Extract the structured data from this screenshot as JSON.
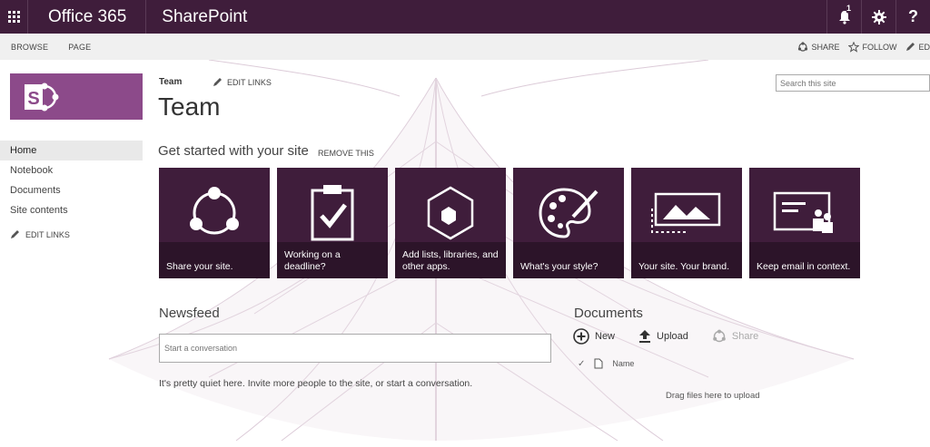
{
  "suitebar": {
    "brand": "Office 365",
    "app": "SharePoint",
    "notification_count": "1",
    "help_label": "?"
  },
  "ribbon": {
    "tabs": [
      "BROWSE",
      "PAGE"
    ],
    "share": "SHARE",
    "follow": "FOLLOW",
    "edit": "ED"
  },
  "nav": {
    "items": [
      "Home",
      "Notebook",
      "Documents",
      "Site contents"
    ],
    "edit_links": "EDIT LINKS"
  },
  "header": {
    "breadcrumb": "Team",
    "edit_links": "EDIT LINKS",
    "title": "Team",
    "search_placeholder": "Search this site"
  },
  "get_started": {
    "title": "Get started with your site",
    "remove": "REMOVE THIS",
    "tiles": [
      {
        "label": "Share your site.",
        "icon": "share-icon"
      },
      {
        "label": "Working on a deadline?",
        "icon": "clipboard-check-icon"
      },
      {
        "label": "Add lists, libraries, and other apps.",
        "icon": "apps-hexagon-icon"
      },
      {
        "label": "What's your style?",
        "icon": "palette-icon"
      },
      {
        "label": "Your site. Your brand.",
        "icon": "image-brand-icon"
      },
      {
        "label": "Keep email in context.",
        "icon": "email-context-icon"
      }
    ]
  },
  "newsfeed": {
    "title": "Newsfeed",
    "placeholder": "Start a conversation",
    "empty_message": "It's pretty quiet here. Invite more people to the site, or start a conversation."
  },
  "documents": {
    "title": "Documents",
    "new": "New",
    "upload": "Upload",
    "share": "Share",
    "column_name": "Name",
    "drag_hint": "Drag files here to upload"
  },
  "colors": {
    "suitebar": "#3f1d3b",
    "tile": "#3f1d3b",
    "logo": "#8c4a8a"
  }
}
